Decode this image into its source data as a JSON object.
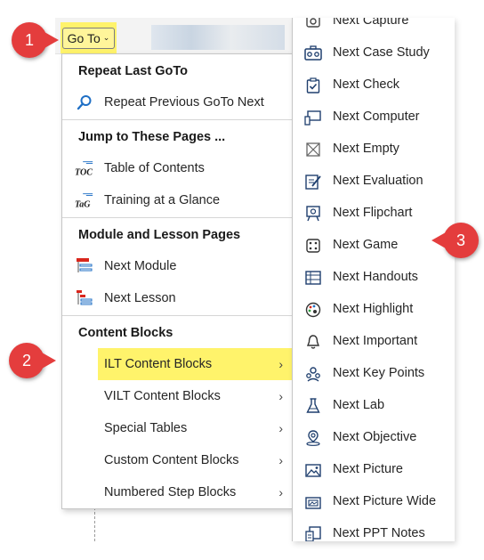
{
  "goto_button": {
    "label": "Go To",
    "chevron": "⌄"
  },
  "menu": {
    "sections": [
      {
        "heading": "Repeat Last GoTo",
        "items": [
          {
            "label": "Repeat Previous GoTo Next",
            "icon": "search-icon"
          }
        ]
      },
      {
        "heading": "Jump to These Pages ...",
        "items": [
          {
            "label": "Table of Contents",
            "icon": "toc-icon",
            "icon_text": "TOC"
          },
          {
            "label": "Training at a Glance",
            "icon": "tag-icon",
            "icon_text": "TaG"
          }
        ]
      },
      {
        "heading": "Module and Lesson Pages",
        "items": [
          {
            "label": "Next Module",
            "icon": "module-icon"
          },
          {
            "label": "Next Lesson",
            "icon": "lesson-icon"
          }
        ]
      },
      {
        "heading": "Content Blocks",
        "items": [
          {
            "label": "ILT Content Blocks",
            "highlighted": true,
            "submenu": true
          },
          {
            "label": "VILT Content Blocks",
            "submenu": true
          },
          {
            "label": "Special Tables",
            "submenu": true
          },
          {
            "label": "Custom Content Blocks",
            "submenu": true
          },
          {
            "label": "Numbered Step Blocks",
            "submenu": true
          }
        ]
      }
    ]
  },
  "submenu": {
    "items": [
      {
        "label": "Next Capture",
        "icon": "capture-icon"
      },
      {
        "label": "Next Case Study",
        "icon": "case-study-icon"
      },
      {
        "label": "Next Check",
        "icon": "check-icon"
      },
      {
        "label": "Next Computer",
        "icon": "computer-icon"
      },
      {
        "label": "Next Empty",
        "icon": "empty-icon"
      },
      {
        "label": "Next Evaluation",
        "icon": "evaluation-icon"
      },
      {
        "label": "Next Flipchart",
        "icon": "flipchart-icon"
      },
      {
        "label": "Next Game",
        "icon": "game-icon"
      },
      {
        "label": "Next Handouts",
        "icon": "handouts-icon"
      },
      {
        "label": "Next Highlight",
        "icon": "highlight-icon"
      },
      {
        "label": "Next Important",
        "icon": "important-icon"
      },
      {
        "label": "Next Key Points",
        "icon": "key-points-icon"
      },
      {
        "label": "Next Lab",
        "icon": "lab-icon"
      },
      {
        "label": "Next Objective",
        "icon": "objective-icon"
      },
      {
        "label": "Next Picture",
        "icon": "picture-icon"
      },
      {
        "label": "Next Picture Wide",
        "icon": "picture-wide-icon"
      },
      {
        "label": "Next PPT Notes",
        "icon": "ppt-notes-icon"
      }
    ]
  },
  "callouts": [
    "1",
    "2",
    "3"
  ],
  "colors": {
    "highlight": "#fff36b",
    "callout": "#e43d3d",
    "accent_blue": "#1f6fc5",
    "accent_red": "#d9261c"
  }
}
